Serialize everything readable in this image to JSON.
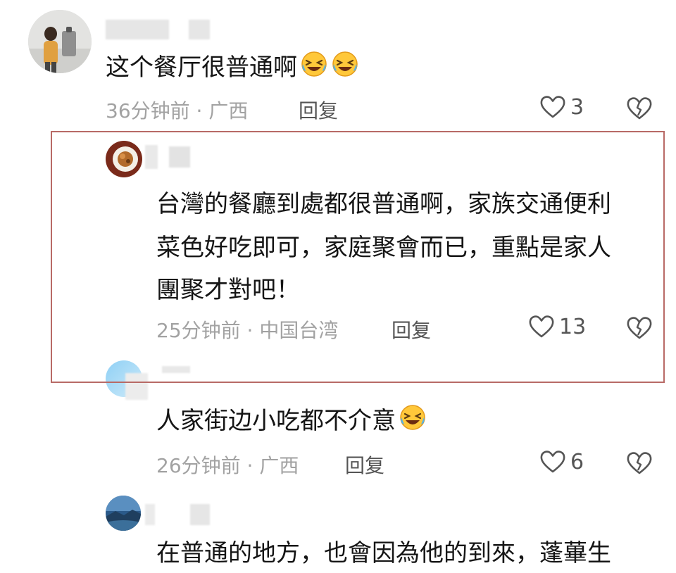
{
  "comments": [
    {
      "text": "这个餐厅很普通啊",
      "emojis": [
        "grinning-squint-tears",
        "grinning-squint-tears"
      ],
      "time_location": "36分钟前 · 广西",
      "reply_label": "回复",
      "likes": "3"
    },
    {
      "text_lines": [
        "台灣的餐廳到處都很普通啊，家族交通便利",
        "菜色好吃即可，家庭聚會而已，重點是家人",
        "團聚才對吧！"
      ],
      "time_location": "25分钟前 · 中国台湾",
      "reply_label": "回复",
      "likes": "13"
    },
    {
      "text": "人家街边小吃都不介意",
      "emojis": [
        "grinning-squint-tears"
      ],
      "time_location": "26分钟前 · 广西",
      "reply_label": "回复",
      "likes": "6"
    },
    {
      "text": "在普通的地方，也會因為他的到來，蓬蓽生"
    }
  ],
  "colors": {
    "highlight_border": "#b86a66",
    "meta_text": "#a2a2a2",
    "emoji_face": "#ffc83a"
  }
}
